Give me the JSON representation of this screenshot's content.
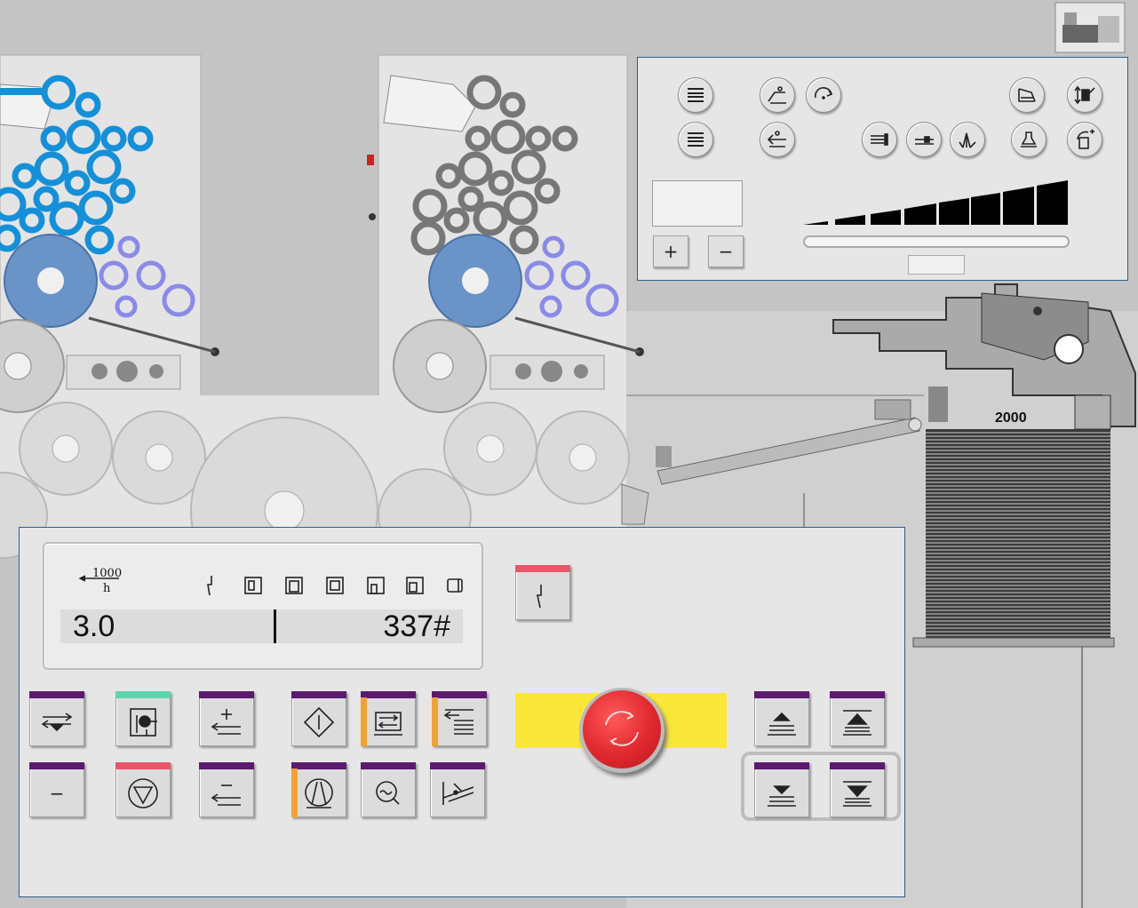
{
  "machine": {
    "pile_count_label": "2000"
  },
  "top_panel": {
    "plus_label": "+",
    "minus_label": "−",
    "slider_level": 0.0
  },
  "display": {
    "speed_unit_top": "1000",
    "speed_unit_bottom": "h",
    "speed_value": "3.0",
    "sheet_count": "337#"
  },
  "colors": {
    "accent_purple": "#5a1a6e",
    "accent_teal": "#5fd3b0",
    "accent_red": "#e8566a",
    "accent_orange": "#f2a230",
    "estop_red": "#e0282f",
    "estop_yellow": "#fbe63a",
    "ink_blue": "#1590d8",
    "panel_border": "#2e5e8c"
  },
  "buttons": {
    "feeder_minus_label": "−"
  }
}
